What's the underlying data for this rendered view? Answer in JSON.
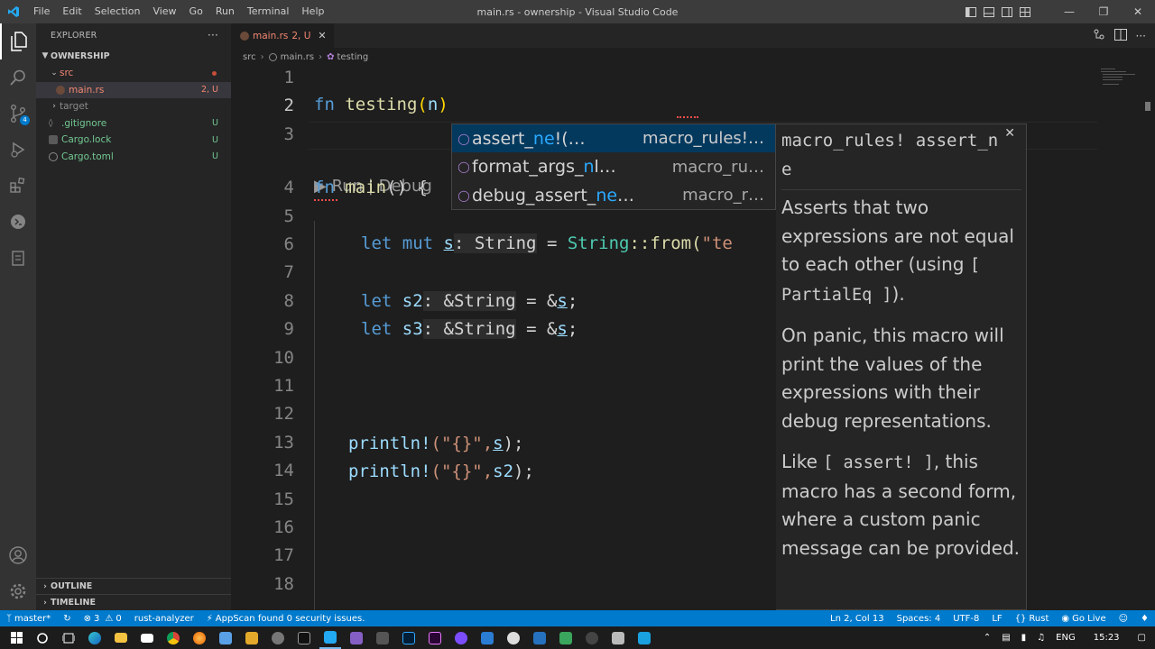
{
  "window": {
    "title": "main.rs - ownership - Visual Studio Code",
    "menu": [
      "File",
      "Edit",
      "Selection",
      "View",
      "Go",
      "Run",
      "Terminal",
      "Help"
    ]
  },
  "sidebar": {
    "title": "EXPLORER",
    "more": "···",
    "project": "OWNERSHIP",
    "tree": [
      {
        "label": "src",
        "type": "folder-open",
        "status": "error-dot"
      },
      {
        "label": "main.rs",
        "type": "file-rust",
        "badge": "2, U",
        "selected": true
      },
      {
        "label": "target",
        "type": "folder-closed",
        "badge": ""
      },
      {
        "label": ".gitignore",
        "type": "file",
        "badge": "U"
      },
      {
        "label": "Cargo.lock",
        "type": "file",
        "badge": "U"
      },
      {
        "label": "Cargo.toml",
        "type": "file",
        "badge": "U"
      }
    ],
    "outline": "OUTLINE",
    "timeline": "TIMELINE"
  },
  "editor": {
    "tab": {
      "label": "main.rs",
      "status": "2, U"
    },
    "breadcrumbs": [
      "src",
      "main.rs",
      "testing"
    ],
    "codelens": "▶ Run | Debug",
    "line_numbers": [
      "1",
      "2",
      "3",
      "4",
      "5",
      "6",
      "7",
      "8",
      "9",
      "10",
      "11",
      "12",
      "13",
      "14",
      "15",
      "16",
      "17",
      "18"
    ],
    "code": {
      "l2": {
        "kw": "fn",
        "name": "testing",
        "open": "(",
        "arg": "n",
        "close": ")"
      },
      "l4": {
        "kw": "fn",
        "name": "main",
        "rest": "() {"
      },
      "l6": {
        "kw": "let mut",
        "var": "s",
        "hint": ": String",
        "eq": " = ",
        "type": "String",
        "call": "::from(",
        "str": "\"te"
      },
      "l8": {
        "kw": "let",
        "var": "s2",
        "hint": ": &String",
        "eq": " = &",
        "ref": "s",
        "end": ";"
      },
      "l9": {
        "kw": "let",
        "var": "s3",
        "hint": ": &String",
        "eq": " = &",
        "ref": "s",
        "end": ";"
      },
      "l13": {
        "macro": "println!",
        "args_a": "(\"{}\",",
        "var": "s",
        "args_b": ");"
      },
      "l14": {
        "macro": "println!",
        "args_a": "(\"{}\",",
        "var": "s2",
        "args_b": ");"
      }
    }
  },
  "suggest": [
    {
      "pre": "assert_",
      "hit": "ne",
      "post": "!(…",
      "detail": "macro_rules!…",
      "focused": true
    },
    {
      "pre": "format_args_",
      "hit": "n",
      "post": "l…",
      "detail": "macro_ru…",
      "focused": false
    },
    {
      "pre": "debug_assert_",
      "hit": "ne",
      "post": "…",
      "detail": "macro_r…",
      "focused": false
    }
  ],
  "docs": {
    "signature": "macro_rules! assert_ne",
    "p1_a": "Asserts that two expressions are not equal to each other (using ",
    "p1_code": "[ PartialEq ]",
    "p1_b": ").",
    "p2": "On panic, this macro will print the values of the expressions with their debug representations.",
    "p3_a": "Like ",
    "p3_code": "[ assert! ]",
    "p3_b": ", this macro has a second form, where a custom panic message can be provided."
  },
  "statusbar": {
    "branch": "master*",
    "sync": "",
    "errors": "3",
    "warnings": "0",
    "analyzer": "rust-analyzer",
    "appscan": "AppScan found 0 security issues.",
    "position": "Ln 2, Col 13",
    "spaces": "Spaces: 4",
    "encoding": "UTF-8",
    "eol": "LF",
    "language": "Rust",
    "golive": "Go Live"
  },
  "taskbar": {
    "lang": "ENG",
    "time": "15:23"
  },
  "colors": {
    "accent": "#007acc",
    "error": "#f14c4c",
    "git_untracked": "#73c991"
  }
}
